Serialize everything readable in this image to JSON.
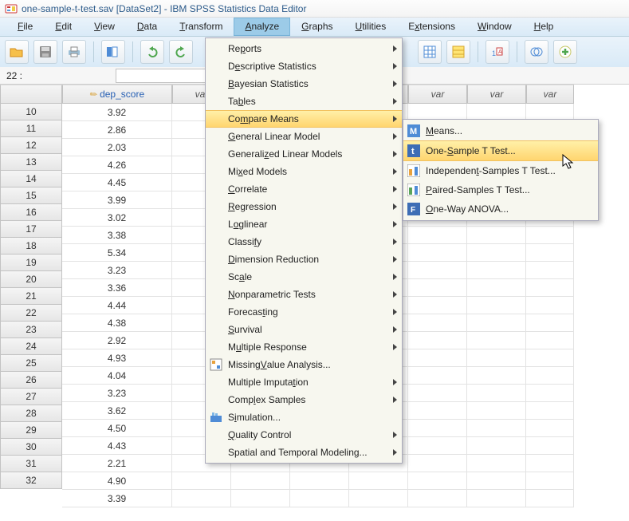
{
  "window": {
    "title": "one-sample-t-test.sav [DataSet2] - IBM SPSS Statistics Data Editor"
  },
  "menubar": {
    "file": "File",
    "edit": "Edit",
    "view": "View",
    "data": "Data",
    "transform": "Transform",
    "analyze": "Analyze",
    "graphs": "Graphs",
    "utilities": "Utilities",
    "extensions": "Extensions",
    "window": "Window",
    "help": "Help"
  },
  "inforow": {
    "label": "22 :",
    "value": ""
  },
  "columns": {
    "dep_score": "dep_score",
    "var": "var"
  },
  "data": {
    "rows": [
      {
        "n": 10,
        "v": "3.92"
      },
      {
        "n": 11,
        "v": "2.86"
      },
      {
        "n": 12,
        "v": "2.03"
      },
      {
        "n": 13,
        "v": "4.26"
      },
      {
        "n": 14,
        "v": "4.45"
      },
      {
        "n": 15,
        "v": "3.99"
      },
      {
        "n": 16,
        "v": "3.02"
      },
      {
        "n": 17,
        "v": "3.38"
      },
      {
        "n": 18,
        "v": "5.34"
      },
      {
        "n": 19,
        "v": "3.23"
      },
      {
        "n": 20,
        "v": "3.36"
      },
      {
        "n": 21,
        "v": "4.44"
      },
      {
        "n": 22,
        "v": "4.38"
      },
      {
        "n": 23,
        "v": "2.92"
      },
      {
        "n": 24,
        "v": "4.93"
      },
      {
        "n": 25,
        "v": "4.04"
      },
      {
        "n": 26,
        "v": "3.23"
      },
      {
        "n": 27,
        "v": "3.62"
      },
      {
        "n": 28,
        "v": "4.50"
      },
      {
        "n": 29,
        "v": "4.43"
      },
      {
        "n": 30,
        "v": "2.21"
      },
      {
        "n": 31,
        "v": "4.90"
      },
      {
        "n": 32,
        "v": "3.39"
      }
    ]
  },
  "analyze_menu": {
    "reports": "Reports",
    "desc": "Descriptive Statistics",
    "bayes": "Bayesian Statistics",
    "tables": "Tables",
    "compare": "Compare Means",
    "glm": "General Linear Model",
    "genlm": "Generalized Linear Models",
    "mixed": "Mixed Models",
    "corr": "Correlate",
    "reg": "Regression",
    "loglin": "Loglinear",
    "classify": "Classify",
    "dimred": "Dimension Reduction",
    "scale": "Scale",
    "nonpar": "Nonparametric Tests",
    "forecast": "Forecasting",
    "survival": "Survival",
    "multres": "Multiple Response",
    "missing": "Missing Value Analysis...",
    "multimp": "Multiple Imputation",
    "complex": "Complex Samples",
    "sim": "Simulation...",
    "qc": "Quality Control",
    "spatial": "Spatial and Temporal Modeling..."
  },
  "compare_submenu": {
    "means": "Means...",
    "one_sample": "One-Sample T Test...",
    "indep": "Independent-Samples T Test...",
    "paired": "Paired-Samples T Test...",
    "anova": "One-Way ANOVA..."
  }
}
